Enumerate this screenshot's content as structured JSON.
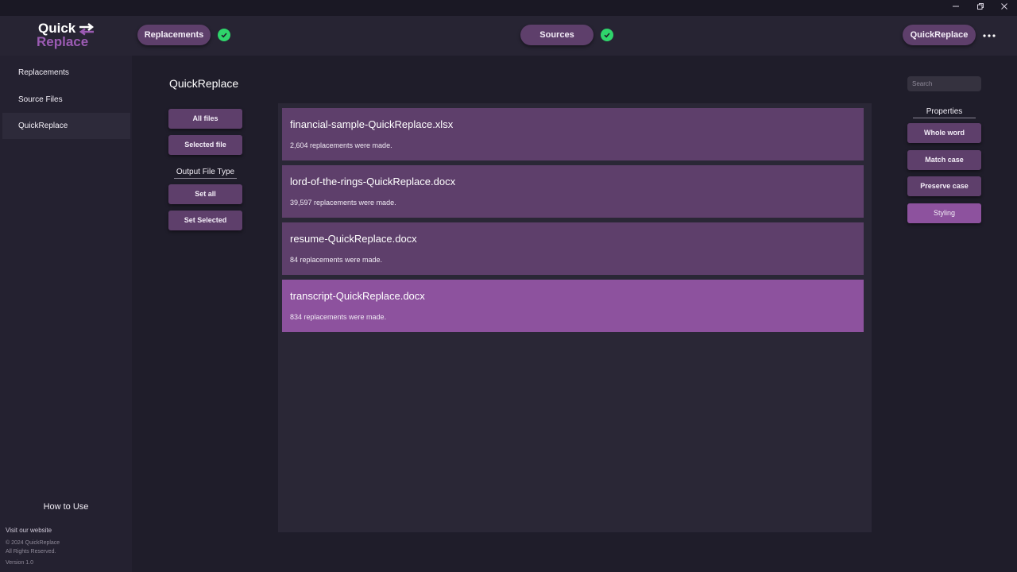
{
  "window": {
    "controls": [
      "minimize-icon",
      "restore-icon",
      "close-icon"
    ]
  },
  "logo": {
    "line1": "Quick",
    "line2": "Replace",
    "icon": "swap-arrows-icon"
  },
  "topbar": {
    "replacements_label": "Replacements",
    "sources_label": "Sources",
    "quickreplace_label": "QuickReplace",
    "menu_icon": "more-horizontal-icon"
  },
  "sidebar": {
    "items": [
      {
        "label": "Replacements"
      },
      {
        "label": "Source Files"
      },
      {
        "label": "QuickReplace"
      }
    ],
    "how_to_use": "How to Use",
    "visit_website": "Visit our website",
    "copyright": "© 2024 QuickReplace",
    "rights": "All Rights Reserved.",
    "version": "Version 1.0"
  },
  "main": {
    "title": "QuickReplace",
    "all_files": "All files",
    "selected_file": "Selected file",
    "output_file_type": "Output File Type",
    "set_all": "Set all",
    "set_selected": "Set Selected"
  },
  "files": [
    {
      "name": "financial-sample-QuickReplace.xlsx",
      "info": "2,604 replacements were made."
    },
    {
      "name": "lord-of-the-rings-QuickReplace.docx",
      "info": "39,597 replacements were made."
    },
    {
      "name": "resume-QuickReplace.docx",
      "info": "84 replacements were made."
    },
    {
      "name": "transcript-QuickReplace.docx",
      "info": "834 replacements were made."
    }
  ],
  "properties": {
    "search_placeholder": "Search",
    "title": "Properties",
    "whole_word": "Whole word",
    "match_case": "Match case",
    "preserve_case": "Preserve case",
    "styling": "Styling"
  },
  "colors": {
    "accent": "#5e3f6b",
    "accent_active": "#8d529e",
    "check": "#2fd46b",
    "background": "#1f1d2a"
  }
}
